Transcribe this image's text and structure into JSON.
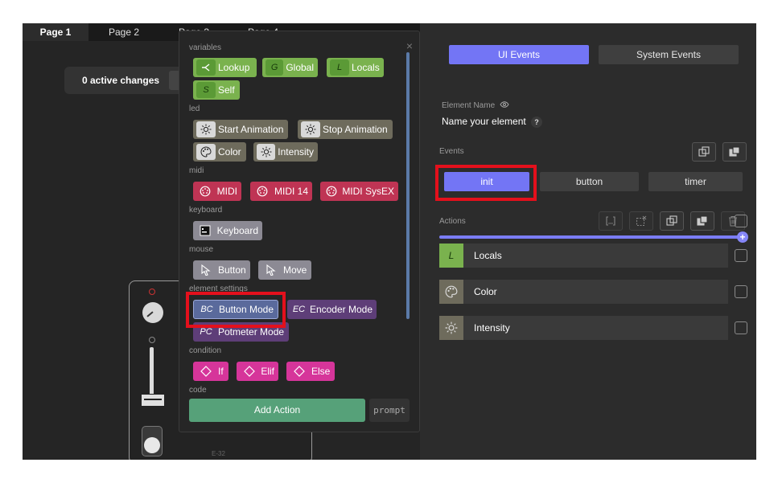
{
  "page_tabs": [
    "Page 1",
    "Page 2",
    "Page 3",
    "Page 4"
  ],
  "changes": {
    "label": "0 active changes"
  },
  "module": {
    "label": "E-32"
  },
  "popup": {
    "categories": {
      "variables": "variables",
      "led": "led",
      "midi": "midi",
      "keyboard": "keyboard",
      "mouse": "mouse",
      "element_settings": "element settings",
      "condition": "condition",
      "code": "code"
    },
    "chips": {
      "lookup": "Lookup",
      "global": "Global",
      "locals": "Locals",
      "self": "Self",
      "start_animation": "Start Animation",
      "stop_animation": "Stop Animation",
      "color": "Color",
      "intensity": "Intensity",
      "midi": "MIDI",
      "midi14": "MIDI 14",
      "midi_sysex": "MIDI SysEX",
      "keyboard": "Keyboard",
      "mouse_button": "Button",
      "mouse_move": "Move",
      "button_mode": "Button Mode",
      "encoder_mode": "Encoder Mode",
      "potmeter_mode": "Potmeter Mode",
      "if": "If",
      "elif": "Elif",
      "else": "Else"
    },
    "icon_letters": {
      "global": "G",
      "locals": "L",
      "self": "S",
      "button_mode": "BC",
      "encoder_mode": "EC",
      "potmeter_mode": "PC"
    },
    "add_action": "Add Action",
    "prompt": "prompt",
    "close": "×"
  },
  "right": {
    "tabs": {
      "ui_events": "UI Events",
      "system_events": "System Events"
    },
    "element_name_label": "Element Name",
    "element_name_value": "Name your element",
    "help": "?",
    "events_label": "Events",
    "events": {
      "init": "init",
      "button": "button",
      "timer": "timer"
    },
    "actions_label": "Actions",
    "progress": 1.0,
    "actions": [
      {
        "icon": "L",
        "label": "Locals"
      },
      {
        "icon": "palette-icon",
        "label": "Color"
      },
      {
        "icon": "sun-icon",
        "label": "Intensity"
      }
    ]
  },
  "colors": {
    "accent": "#7375f5",
    "highlight": "#e4101c",
    "variables": "#7ab24e",
    "midi": "#bf3454",
    "condition": "#d6359a",
    "add_action": "#56a179"
  }
}
